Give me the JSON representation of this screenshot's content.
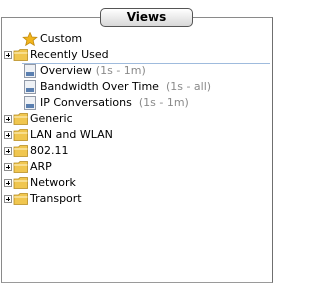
{
  "header": {
    "views_label": "Views"
  },
  "tree": {
    "custom": {
      "label": "Custom",
      "icon": "star-icon"
    },
    "recently_used": {
      "label": "Recently Used",
      "icon": "folder-icon",
      "children": [
        {
          "label": "Overview",
          "range": "(1s - 1m)",
          "icon": "view-document-icon"
        },
        {
          "label": "Bandwidth Over Time",
          "range": "(1s - all)",
          "icon": "view-document-icon"
        },
        {
          "label": "IP Conversations",
          "range": "(1s - 1m)",
          "icon": "view-document-icon"
        }
      ]
    },
    "folders": [
      {
        "label": "Generic",
        "icon": "folder-icon"
      },
      {
        "label": "LAN and WLAN",
        "icon": "folder-icon"
      },
      {
        "label": "802.11",
        "icon": "folder-icon"
      },
      {
        "label": "ARP",
        "icon": "folder-icon"
      },
      {
        "label": "Network",
        "icon": "folder-icon"
      },
      {
        "label": "Transport",
        "icon": "folder-icon"
      }
    ]
  },
  "colors": {
    "folder": "#f0c64f",
    "star": "#f2b51c",
    "selection_line": "#9fbbdd",
    "subtext": "#8a8a8a"
  }
}
